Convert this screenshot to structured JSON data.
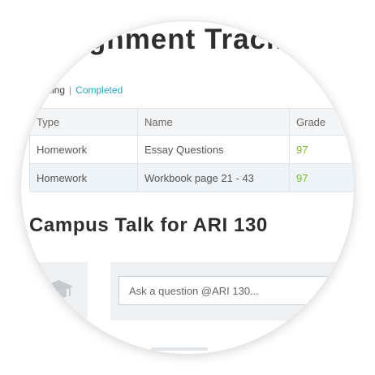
{
  "tracker": {
    "title": "Assignment Tracker",
    "filters": {
      "upcoming_label": "Upcoming",
      "separator": "|",
      "completed_label": "Completed"
    },
    "columns": [
      "Type",
      "Name",
      "Grade"
    ],
    "rows": [
      {
        "type": "Homework",
        "name": "Essay Questions",
        "grade": "97"
      },
      {
        "type": "Homework",
        "name": "Workbook page 21 - 43",
        "grade": "97"
      }
    ]
  },
  "campus_talk": {
    "title": "Campus Talk for ARI 130",
    "avatar_icon": "graduation-cap-icon",
    "ask_placeholder": "Ask a question @ARI 130..."
  },
  "colors": {
    "grade": "#7cbb2e",
    "link": "#2aa1c0",
    "row_highlight": "#eef3f8"
  }
}
